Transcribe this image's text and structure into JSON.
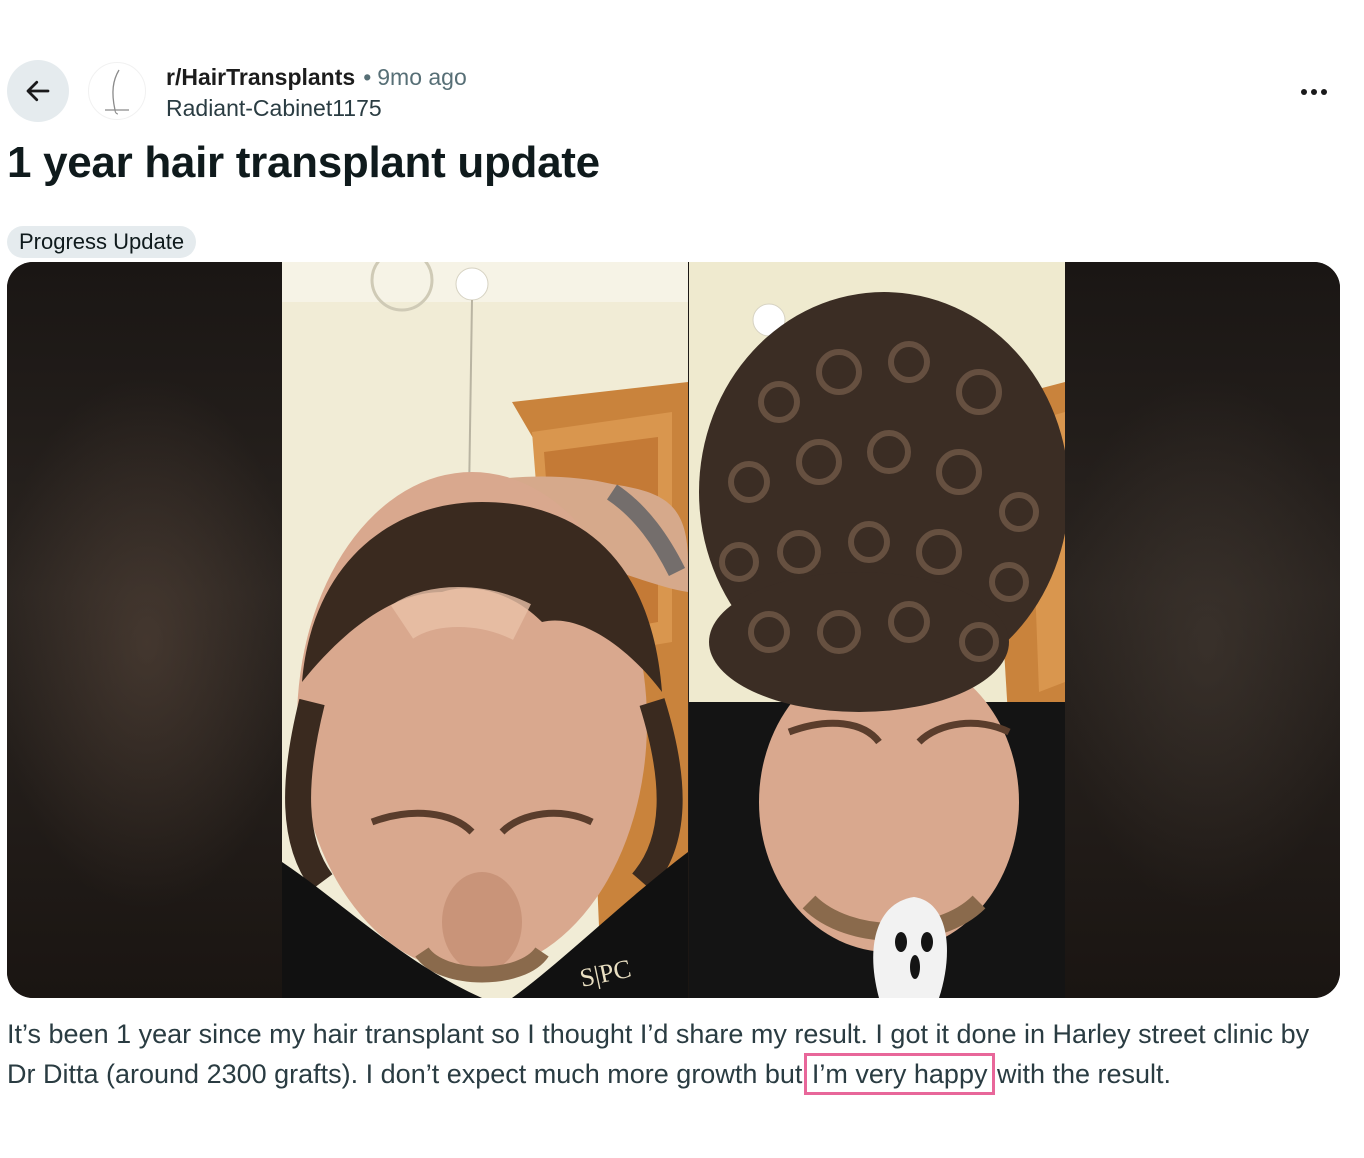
{
  "post": {
    "subreddit": "r/HairTransplants",
    "separator": "•",
    "time_ago": "9mo ago",
    "author": "Radiant-Cabinet1175",
    "title": "1 year hair transplant update",
    "flair": "Progress Update",
    "body_before": "It’s been 1 year since my hair transplant so I thought I’d share my result. I got it done in Harley street clinic by Dr Ditta (around 2300 grafts). I don’t expect much more growth but ",
    "body_highlight": "I’m very happy",
    "body_after": " with the result."
  },
  "icons": {
    "back": "arrow-left-icon",
    "subreddit_avatar": "hair-strand-icon",
    "more": "ellipsis-icon"
  },
  "colors": {
    "back_bg": "#e5ebee",
    "flair_bg": "#e5ebee",
    "highlight_outline": "#e8679a",
    "muted_text": "#576f76"
  }
}
